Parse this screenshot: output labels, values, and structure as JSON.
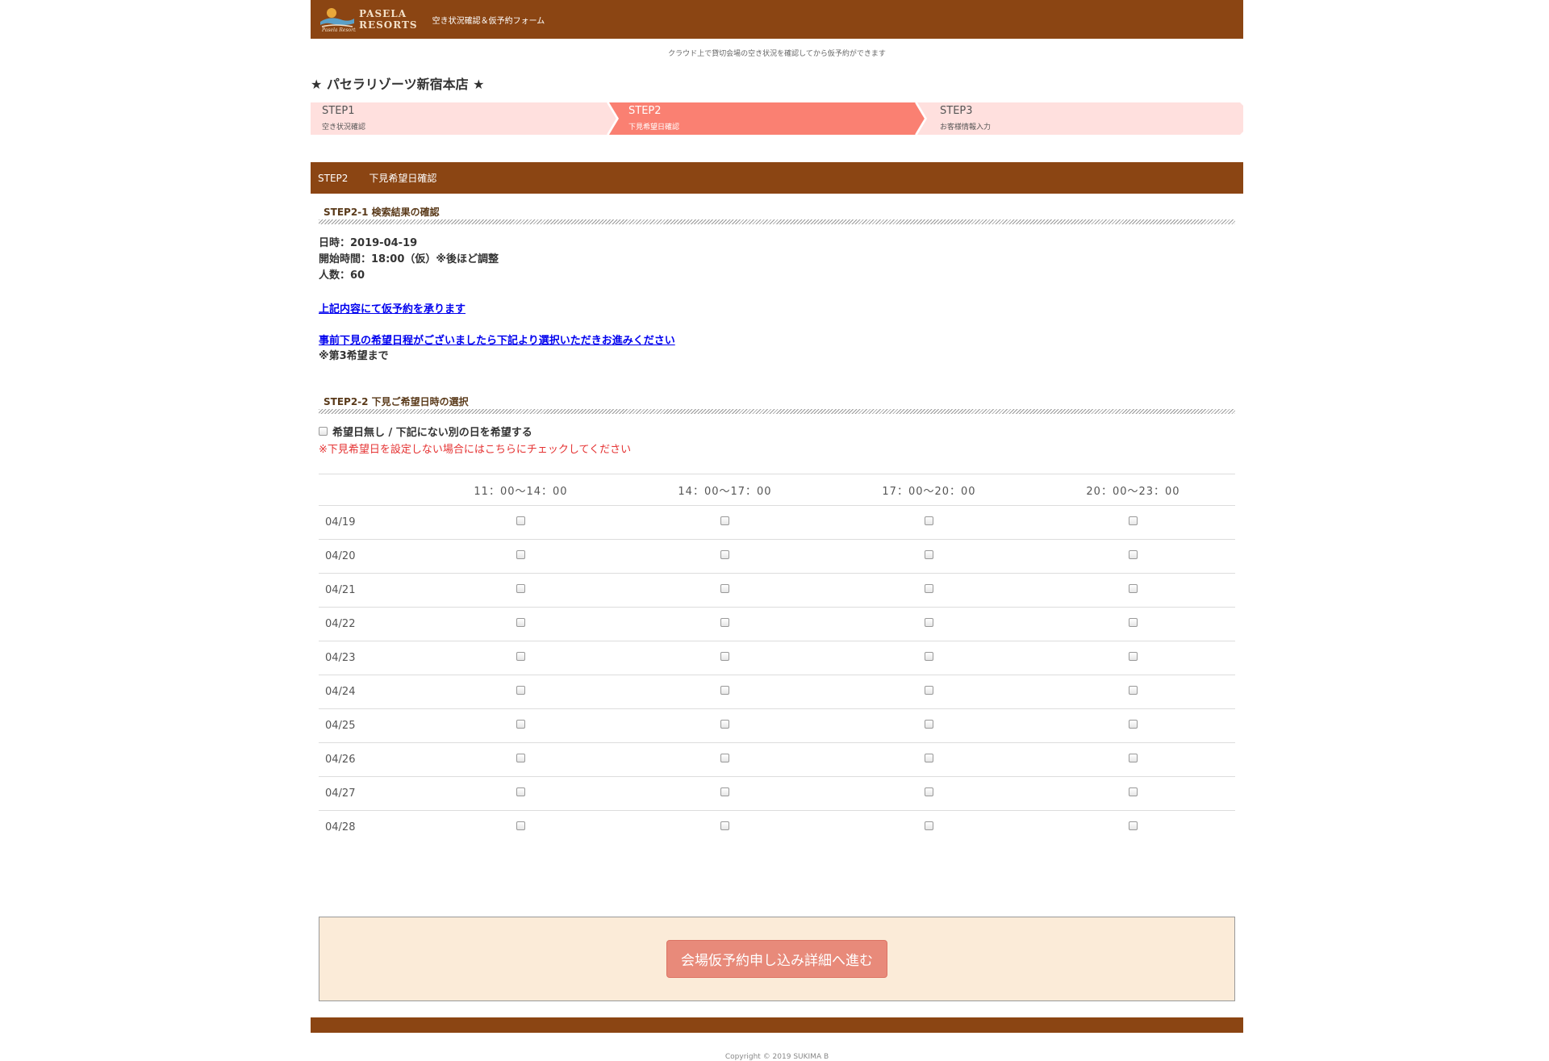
{
  "header": {
    "brand_line1": "PASELA",
    "brand_line2": "RESORTS",
    "title": "空き状況確認＆仮予約フォーム"
  },
  "tagline": "クラウド上で貸切会場の空き状況を確認してから仮予約ができます",
  "store_title": "★ パセラリゾーツ新宿本店 ★",
  "steps": [
    {
      "num": "STEP1",
      "sub": "空き状況確認"
    },
    {
      "num": "STEP2",
      "sub": "下見希望日確認"
    },
    {
      "num": "STEP3",
      "sub": "お客様情報入力"
    }
  ],
  "section_bar": {
    "step": "STEP2",
    "title": "下見希望日確認"
  },
  "step21": {
    "heading": "STEP2-1  検索結果の確認",
    "date_line": "日時：2019-04-19",
    "time_line": "開始時間：18:00（仮）※後ほど調整",
    "people_line": "人数：60",
    "link1": "上記内容にて仮予約を承ります",
    "link2": "事前下見の希望日程がございましたら下記より選択いただきお進みください",
    "note": "※第3希望まで"
  },
  "step22": {
    "heading": "STEP2-2  下見ご希望日時の選択",
    "no_pref_label": "希望日無し / 下記にない別の日を希望する",
    "red_note": "※下見希望日を設定しない場合にはこちらにチェックしてください"
  },
  "time_slots": [
    "11：00〜14：00",
    "14：00〜17：00",
    "17：00〜20：00",
    "20：00〜23：00"
  ],
  "dates": [
    "04/19",
    "04/20",
    "04/21",
    "04/22",
    "04/23",
    "04/24",
    "04/25",
    "04/26",
    "04/27",
    "04/28"
  ],
  "submit_label": "会場仮予約申し込み詳細へ進む",
  "copyright": "Copyright © 2019 SUKIMA B",
  "colors": {
    "brown": "#8b4513",
    "step_light": "#ffe0de",
    "step_active": "#fa8072",
    "submit_bg": "#fbebd8",
    "button": "#e88a7a"
  }
}
